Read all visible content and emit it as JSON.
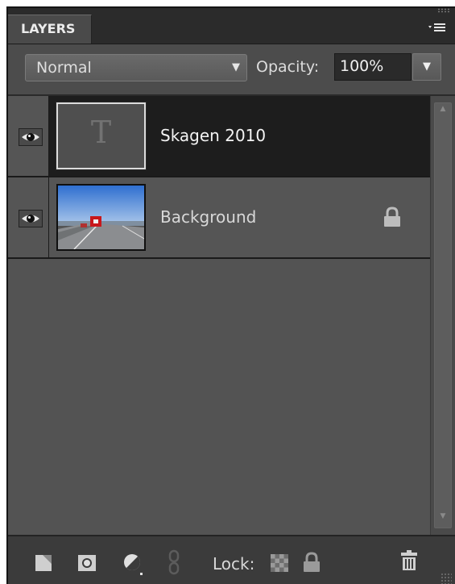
{
  "panel": {
    "tab_label": "LAYERS",
    "menu_icon": "panel-menu-icon"
  },
  "mode": {
    "blend_mode": "Normal",
    "opacity_label": "Opacity:",
    "opacity_value": "100%"
  },
  "layers": [
    {
      "name": "Skagen 2010",
      "type": "text",
      "visible": true,
      "selected": true,
      "locked": false,
      "thumb_glyph": "T"
    },
    {
      "name": "Background",
      "type": "image",
      "visible": true,
      "selected": false,
      "locked": true
    }
  ],
  "footer": {
    "lock_label": "Lock:",
    "icons": [
      "new-layer-icon",
      "add-mask-icon",
      "adjustment-layer-icon",
      "link-layers-icon",
      "lock-transparent-pixels-icon",
      "lock-all-icon",
      "delete-layer-icon"
    ]
  },
  "colors": {
    "panel_bg": "#535353",
    "selected_row": "#1d1d1d",
    "header_bg": "#2b2b2b",
    "footer_bg": "#3b3b3b"
  }
}
